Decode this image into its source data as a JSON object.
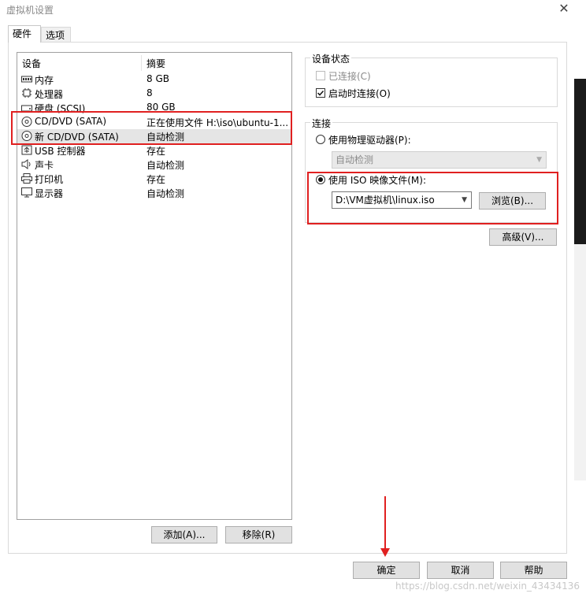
{
  "window": {
    "title": "虚拟机设置",
    "close_icon": "close-icon"
  },
  "tabs": [
    {
      "label": "硬件",
      "active": true
    },
    {
      "label": "选项",
      "active": false
    }
  ],
  "device_list": {
    "headers": {
      "device": "设备",
      "summary": "摘要"
    },
    "rows": [
      {
        "name": "内存",
        "summary": "8 GB",
        "icon": "memory-icon"
      },
      {
        "name": "处理器",
        "summary": "8",
        "icon": "processor-icon"
      },
      {
        "name": "硬盘 (SCSI)",
        "summary": "80 GB",
        "icon": "hard-disk-icon"
      },
      {
        "name": "CD/DVD (SATA)",
        "summary": "正在使用文件 H:\\iso\\ubuntu-1...",
        "icon": "cd-dvd-icon"
      },
      {
        "name": "新 CD/DVD (SATA)",
        "summary": "自动检测",
        "icon": "cd-dvd-icon",
        "selected": true
      },
      {
        "name": "USB 控制器",
        "summary": "存在",
        "icon": "usb-icon"
      },
      {
        "name": "声卡",
        "summary": "自动检测",
        "icon": "sound-card-icon"
      },
      {
        "name": "打印机",
        "summary": "存在",
        "icon": "printer-icon"
      },
      {
        "name": "显示器",
        "summary": "自动检测",
        "icon": "monitor-icon"
      }
    ],
    "add_button": "添加(A)...",
    "remove_button": "移除(R)"
  },
  "device_status": {
    "label": "设备状态",
    "connected": {
      "label": "已连接(C)",
      "checked": false,
      "disabled": true
    },
    "connect_on_power": {
      "label": "启动时连接(O)",
      "checked": true
    }
  },
  "connection": {
    "label": "连接",
    "physical": {
      "label": "使用物理驱动器(P):",
      "selected": false,
      "dropdown_value": "自动检测"
    },
    "iso": {
      "label": "使用 ISO 映像文件(M):",
      "selected": true,
      "path": "D:\\VM虚拟机\\linux.iso",
      "browse_button": "浏览(B)..."
    }
  },
  "advanced_button": "高级(V)...",
  "footer": {
    "ok": "确定",
    "cancel": "取消",
    "help": "帮助"
  },
  "watermark": "https://blog.csdn.net/weixin_43434136",
  "colors": {
    "highlight_red": "#e02020",
    "selected_row": "#e5e5e5"
  }
}
